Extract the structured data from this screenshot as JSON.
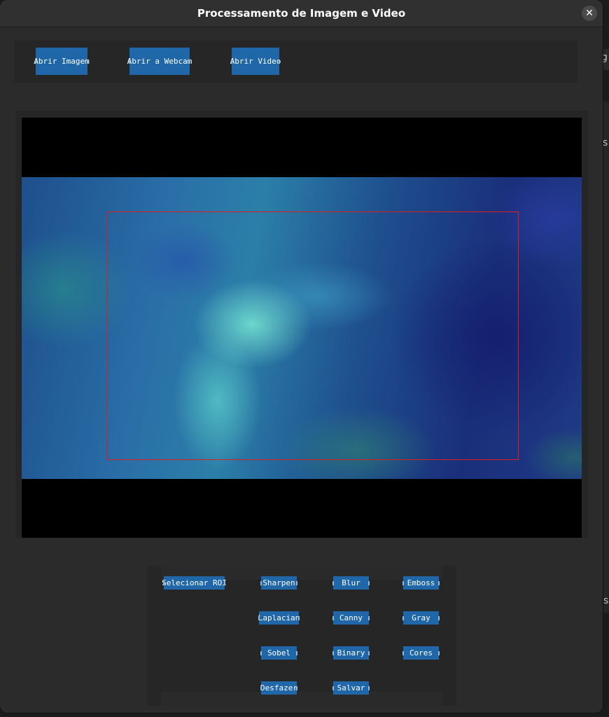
{
  "window": {
    "title": "Processamento de Imagem e Video",
    "close_label": "✕"
  },
  "background_fragments": {
    "text_1": "g",
    "text_2": "s",
    "text_3": "s"
  },
  "open_buttons": [
    {
      "label": "Abrir Imagem"
    },
    {
      "label": "Abrir a Webcam"
    },
    {
      "label": "Abrir Video"
    }
  ],
  "filter_buttons": {
    "select_roi": "Selecionar ROI",
    "sharpen": "Sharpen",
    "blur": "Blur",
    "emboss": "Emboss",
    "laplacian": "Laplacian",
    "canny": "Canny",
    "gray": "Gray",
    "sobel": "Sobel",
    "binary": "Binary",
    "cores": "Cores",
    "desfazer": "Desfazer",
    "salvar": "Salvar"
  },
  "colors": {
    "button_blue": "#1f67a8",
    "roi_red": "#e11c1c",
    "window_bg": "#2b2b2b"
  }
}
